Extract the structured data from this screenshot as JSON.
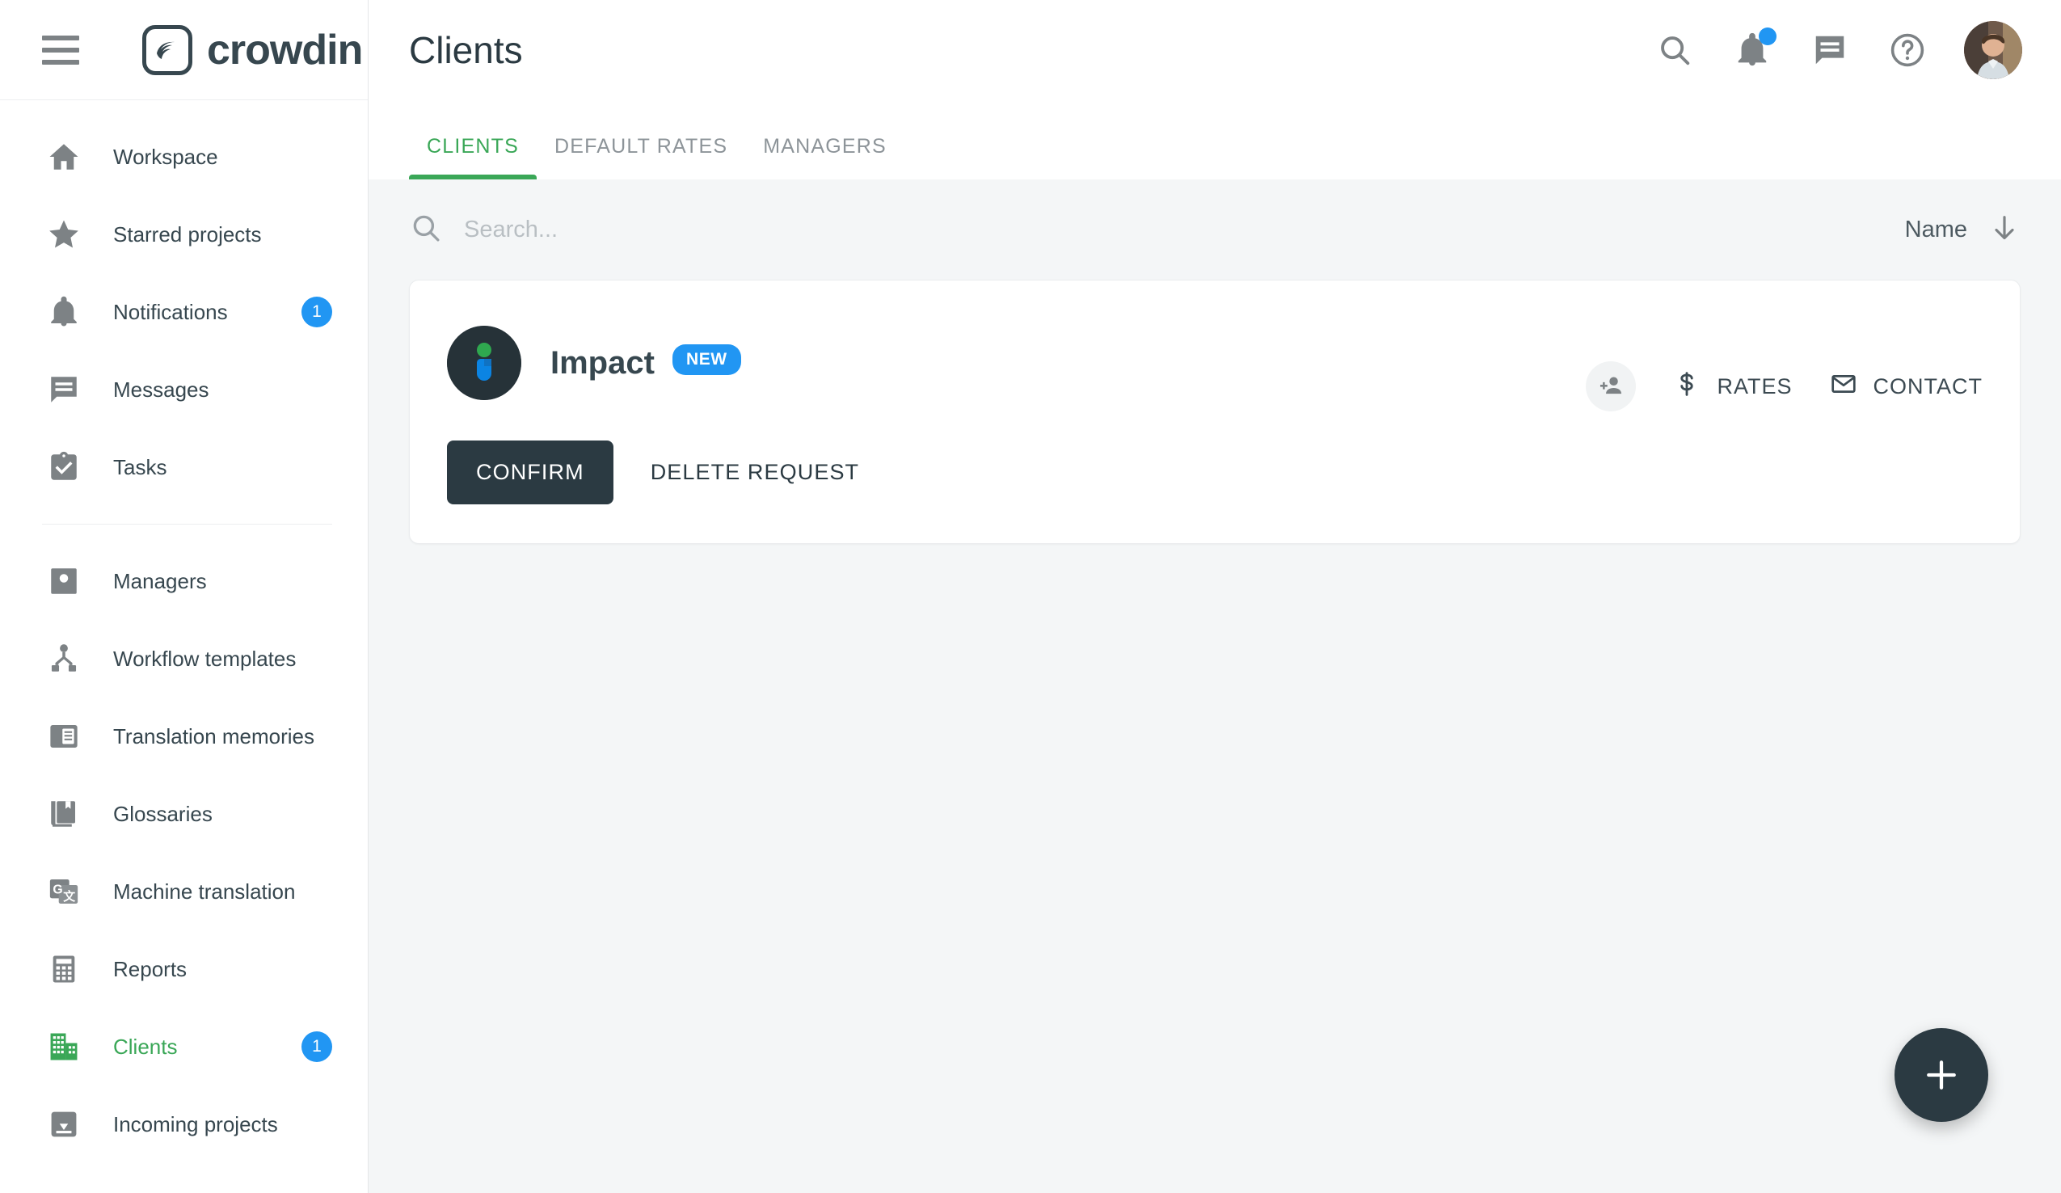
{
  "brand": {
    "name": "crowdin"
  },
  "sidebar": {
    "items": [
      {
        "label": "Workspace",
        "icon": "home-icon",
        "badge": null,
        "active": false
      },
      {
        "label": "Starred projects",
        "icon": "star-icon",
        "badge": null,
        "active": false
      },
      {
        "label": "Notifications",
        "icon": "bell-icon",
        "badge": "1",
        "active": false
      },
      {
        "label": "Messages",
        "icon": "message-icon",
        "badge": null,
        "active": false
      },
      {
        "label": "Tasks",
        "icon": "task-clipboard-icon",
        "badge": null,
        "active": false
      },
      {
        "label": "Managers",
        "icon": "person-card-icon",
        "badge": null,
        "active": false
      },
      {
        "label": "Workflow templates",
        "icon": "workflow-icon",
        "badge": null,
        "active": false
      },
      {
        "label": "Translation memories",
        "icon": "translation-memory-icon",
        "badge": null,
        "active": false
      },
      {
        "label": "Glossaries",
        "icon": "glossary-book-icon",
        "badge": null,
        "active": false
      },
      {
        "label": "Machine translation",
        "icon": "machine-translation-icon",
        "badge": null,
        "active": false
      },
      {
        "label": "Reports",
        "icon": "reports-calculator-icon",
        "badge": null,
        "active": false
      },
      {
        "label": "Clients",
        "icon": "clients-building-icon",
        "badge": "1",
        "active": true
      },
      {
        "label": "Incoming projects",
        "icon": "incoming-projects-icon",
        "badge": null,
        "active": false
      }
    ]
  },
  "header": {
    "title": "Clients",
    "icons": [
      "search-icon",
      "bell-icon",
      "message-icon",
      "help-icon",
      "avatar"
    ],
    "notification_dot": true
  },
  "tabs": [
    {
      "label": "CLIENTS",
      "active": true
    },
    {
      "label": "DEFAULT RATES",
      "active": false
    },
    {
      "label": "MANAGERS",
      "active": false
    }
  ],
  "toolbar": {
    "search_placeholder": "Search...",
    "search_value": "",
    "sort_label": "Name",
    "sort_direction": "descending"
  },
  "clients": [
    {
      "name": "Impact",
      "badge": "NEW",
      "actions": {
        "invite_label": "",
        "rates_label": "RATES",
        "contact_label": "CONTACT",
        "confirm_label": "CONFIRM",
        "delete_label": "DELETE REQUEST"
      }
    }
  ],
  "fab": {
    "label": "+"
  },
  "colors": {
    "accent_green": "#3aa757",
    "badge_blue": "#2196f3",
    "dark": "#2b3a42",
    "page_bg": "#f4f6f7",
    "icon_gray": "#7d8285"
  }
}
